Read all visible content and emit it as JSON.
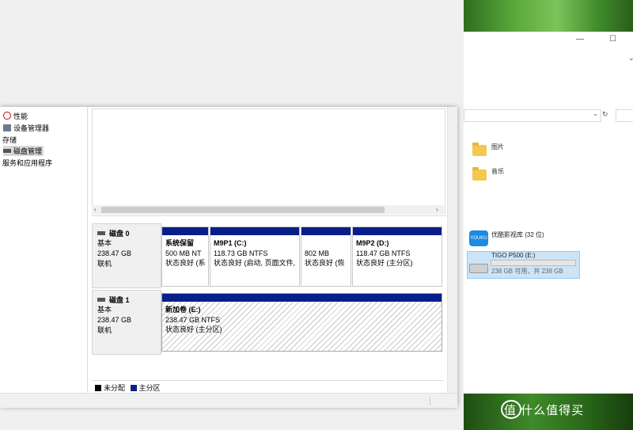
{
  "tree": {
    "items": [
      {
        "label": "性能"
      },
      {
        "label": "设备管理器"
      },
      {
        "label": "存储"
      },
      {
        "label": "磁盘管理"
      },
      {
        "label": "服务和应用程序"
      }
    ]
  },
  "disks": [
    {
      "name": "磁盘 0",
      "type": "基本",
      "size": "238.47 GB",
      "status": "联机",
      "partitions": [
        {
          "name": "系统保留",
          "size": "500 MB NT",
          "status": "状态良好 (系"
        },
        {
          "name": "M9P1  (C:)",
          "size": "118.73 GB NTFS",
          "status": "状态良好 (启动, 页面文件,"
        },
        {
          "name": "",
          "size": "802 MB",
          "status": "状态良好 (恢"
        },
        {
          "name": "M9P2  (D:)",
          "size": "118.47 GB NTFS",
          "status": "状态良好 (主分区)"
        }
      ]
    },
    {
      "name": "磁盘 1",
      "type": "基本",
      "size": "238.47 GB",
      "status": "联机",
      "partitions": [
        {
          "name": "新加卷  (E:)",
          "size": "238.47 GB NTFS",
          "status": "状态良好 (主分区)"
        }
      ]
    }
  ],
  "legend": {
    "unallocated": "未分配",
    "primary": "主分区"
  },
  "explorer": {
    "folders": [
      {
        "label": "图片"
      },
      {
        "label": "音乐"
      }
    ],
    "library": "优酷影视库 (32 位)",
    "drive": {
      "name": "TIGO P500 (E:)",
      "free": "238 GB 可用，共 238 GB",
      "used_fraction": 0.0
    },
    "watermark": "值 什么值得买"
  },
  "colors": {
    "partition_bar": "#0a1e8a",
    "unallocated": "#000000",
    "selection": "#cce4f7"
  }
}
